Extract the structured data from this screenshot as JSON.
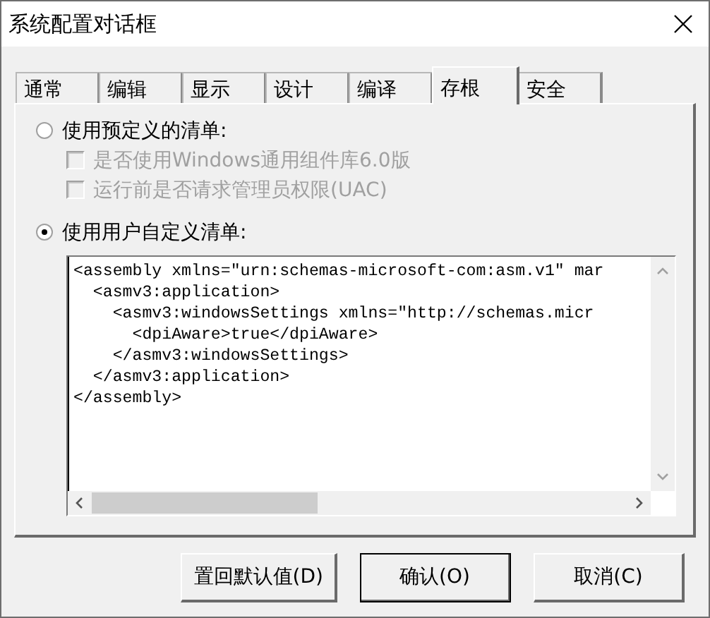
{
  "window": {
    "title": "系统配置对话框"
  },
  "tabs": [
    {
      "label": "通常",
      "selected": false
    },
    {
      "label": "编辑",
      "selected": false
    },
    {
      "label": "显示",
      "selected": false
    },
    {
      "label": "设计",
      "selected": false
    },
    {
      "label": "编译",
      "selected": false
    },
    {
      "label": "存根",
      "selected": true
    },
    {
      "label": "安全",
      "selected": false
    }
  ],
  "options": [
    {
      "kind": "radio",
      "label": "使用预定义的清单:",
      "selected": false,
      "disabled": false
    },
    {
      "kind": "checkbox",
      "label": "是否使用Windows通用组件库6.0版",
      "checked": false,
      "disabled": true
    },
    {
      "kind": "checkbox",
      "label": "运行前是否请求管理员权限(UAC)",
      "checked": false,
      "disabled": true
    },
    {
      "kind": "radio",
      "label": "使用用户自定义清单:",
      "selected": true,
      "disabled": false
    }
  ],
  "editor": {
    "value": "<assembly xmlns=\"urn:schemas-microsoft-com:asm.v1\" mar\n  <asmv3:application>\n    <asmv3:windowsSettings xmlns=\"http://schemas.micr\n      <dpiAware>true</dpiAware>\n    </asmv3:windowsSettings>\n  </asmv3:application>\n</assembly>"
  },
  "buttons": [
    {
      "label": "置回默认值(D)",
      "default": false
    },
    {
      "label": "确认(O)",
      "default": true
    },
    {
      "label": "取消(C)",
      "default": false
    }
  ]
}
